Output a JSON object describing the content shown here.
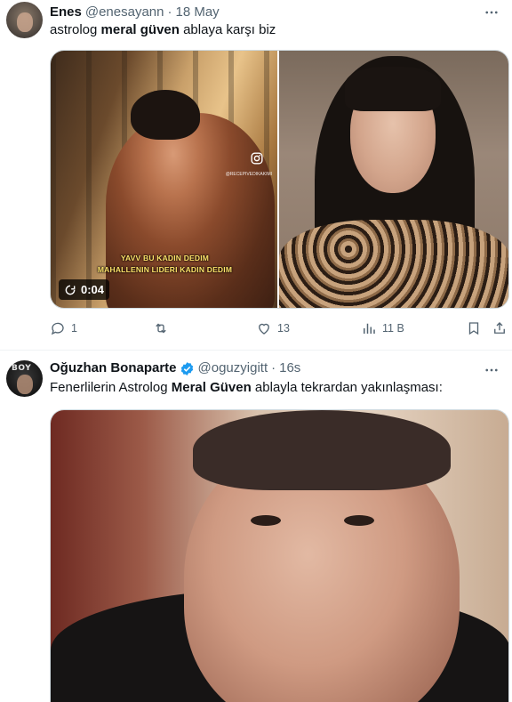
{
  "tweets": [
    {
      "author": {
        "display_name": "Enes",
        "handle": "@enesayann",
        "separator": "·",
        "time": "18 May",
        "verified": false
      },
      "text": {
        "before": "astrolog ",
        "bold": "meral güven",
        "after": " ablaya karşı biz"
      },
      "media": {
        "left": {
          "caption_line1": "YAVV BU KADIN DEDIM",
          "caption_line2": "MAHALLENIN LIDERI KADIN DEDIM",
          "watermark": "@RECEPIVEDIKAKIMI",
          "duration": "0:04"
        }
      },
      "actions": {
        "replies": "1",
        "retweets": "",
        "likes": "13",
        "views": "11 B"
      }
    },
    {
      "author": {
        "display_name": "Oğuzhan Bonaparte",
        "handle": "@oguzyigitt",
        "separator": "·",
        "time": "16s",
        "verified": true
      },
      "avatar_text": "BOY",
      "text": {
        "before": "Fenerlilerin Astrolog ",
        "bold": "Meral Güven",
        "after": " ablayla tekrardan yakınlaşması:"
      }
    }
  ],
  "icons": {
    "more": "more-horizontal-icon",
    "reply": "reply-icon",
    "retweet": "retweet-icon",
    "like": "heart-icon",
    "views": "views-chart-icon",
    "bookmark": "bookmark-icon",
    "share": "share-icon",
    "verified": "verified-badge-icon",
    "replay": "replay-icon",
    "instagram": "instagram-icon"
  },
  "colors": {
    "text_primary": "#0f1419",
    "text_secondary": "#536471",
    "verified_blue": "#1d9bf0",
    "caption_yellow": "#ffe36a",
    "border": "#cfd9de"
  }
}
